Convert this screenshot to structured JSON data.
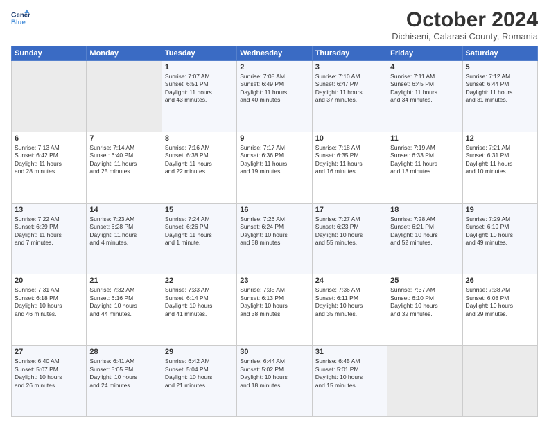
{
  "header": {
    "logo_line1": "General",
    "logo_line2": "Blue",
    "month": "October 2024",
    "location": "Dichiseni, Calarasi County, Romania"
  },
  "weekdays": [
    "Sunday",
    "Monday",
    "Tuesday",
    "Wednesday",
    "Thursday",
    "Friday",
    "Saturday"
  ],
  "weeks": [
    [
      {
        "day": "",
        "text": ""
      },
      {
        "day": "",
        "text": ""
      },
      {
        "day": "1",
        "text": "Sunrise: 7:07 AM\nSunset: 6:51 PM\nDaylight: 11 hours\nand 43 minutes."
      },
      {
        "day": "2",
        "text": "Sunrise: 7:08 AM\nSunset: 6:49 PM\nDaylight: 11 hours\nand 40 minutes."
      },
      {
        "day": "3",
        "text": "Sunrise: 7:10 AM\nSunset: 6:47 PM\nDaylight: 11 hours\nand 37 minutes."
      },
      {
        "day": "4",
        "text": "Sunrise: 7:11 AM\nSunset: 6:45 PM\nDaylight: 11 hours\nand 34 minutes."
      },
      {
        "day": "5",
        "text": "Sunrise: 7:12 AM\nSunset: 6:44 PM\nDaylight: 11 hours\nand 31 minutes."
      }
    ],
    [
      {
        "day": "6",
        "text": "Sunrise: 7:13 AM\nSunset: 6:42 PM\nDaylight: 11 hours\nand 28 minutes."
      },
      {
        "day": "7",
        "text": "Sunrise: 7:14 AM\nSunset: 6:40 PM\nDaylight: 11 hours\nand 25 minutes."
      },
      {
        "day": "8",
        "text": "Sunrise: 7:16 AM\nSunset: 6:38 PM\nDaylight: 11 hours\nand 22 minutes."
      },
      {
        "day": "9",
        "text": "Sunrise: 7:17 AM\nSunset: 6:36 PM\nDaylight: 11 hours\nand 19 minutes."
      },
      {
        "day": "10",
        "text": "Sunrise: 7:18 AM\nSunset: 6:35 PM\nDaylight: 11 hours\nand 16 minutes."
      },
      {
        "day": "11",
        "text": "Sunrise: 7:19 AM\nSunset: 6:33 PM\nDaylight: 11 hours\nand 13 minutes."
      },
      {
        "day": "12",
        "text": "Sunrise: 7:21 AM\nSunset: 6:31 PM\nDaylight: 11 hours\nand 10 minutes."
      }
    ],
    [
      {
        "day": "13",
        "text": "Sunrise: 7:22 AM\nSunset: 6:29 PM\nDaylight: 11 hours\nand 7 minutes."
      },
      {
        "day": "14",
        "text": "Sunrise: 7:23 AM\nSunset: 6:28 PM\nDaylight: 11 hours\nand 4 minutes."
      },
      {
        "day": "15",
        "text": "Sunrise: 7:24 AM\nSunset: 6:26 PM\nDaylight: 11 hours\nand 1 minute."
      },
      {
        "day": "16",
        "text": "Sunrise: 7:26 AM\nSunset: 6:24 PM\nDaylight: 10 hours\nand 58 minutes."
      },
      {
        "day": "17",
        "text": "Sunrise: 7:27 AM\nSunset: 6:23 PM\nDaylight: 10 hours\nand 55 minutes."
      },
      {
        "day": "18",
        "text": "Sunrise: 7:28 AM\nSunset: 6:21 PM\nDaylight: 10 hours\nand 52 minutes."
      },
      {
        "day": "19",
        "text": "Sunrise: 7:29 AM\nSunset: 6:19 PM\nDaylight: 10 hours\nand 49 minutes."
      }
    ],
    [
      {
        "day": "20",
        "text": "Sunrise: 7:31 AM\nSunset: 6:18 PM\nDaylight: 10 hours\nand 46 minutes."
      },
      {
        "day": "21",
        "text": "Sunrise: 7:32 AM\nSunset: 6:16 PM\nDaylight: 10 hours\nand 44 minutes."
      },
      {
        "day": "22",
        "text": "Sunrise: 7:33 AM\nSunset: 6:14 PM\nDaylight: 10 hours\nand 41 minutes."
      },
      {
        "day": "23",
        "text": "Sunrise: 7:35 AM\nSunset: 6:13 PM\nDaylight: 10 hours\nand 38 minutes."
      },
      {
        "day": "24",
        "text": "Sunrise: 7:36 AM\nSunset: 6:11 PM\nDaylight: 10 hours\nand 35 minutes."
      },
      {
        "day": "25",
        "text": "Sunrise: 7:37 AM\nSunset: 6:10 PM\nDaylight: 10 hours\nand 32 minutes."
      },
      {
        "day": "26",
        "text": "Sunrise: 7:38 AM\nSunset: 6:08 PM\nDaylight: 10 hours\nand 29 minutes."
      }
    ],
    [
      {
        "day": "27",
        "text": "Sunrise: 6:40 AM\nSunset: 5:07 PM\nDaylight: 10 hours\nand 26 minutes."
      },
      {
        "day": "28",
        "text": "Sunrise: 6:41 AM\nSunset: 5:05 PM\nDaylight: 10 hours\nand 24 minutes."
      },
      {
        "day": "29",
        "text": "Sunrise: 6:42 AM\nSunset: 5:04 PM\nDaylight: 10 hours\nand 21 minutes."
      },
      {
        "day": "30",
        "text": "Sunrise: 6:44 AM\nSunset: 5:02 PM\nDaylight: 10 hours\nand 18 minutes."
      },
      {
        "day": "31",
        "text": "Sunrise: 6:45 AM\nSunset: 5:01 PM\nDaylight: 10 hours\nand 15 minutes."
      },
      {
        "day": "",
        "text": ""
      },
      {
        "day": "",
        "text": ""
      }
    ]
  ]
}
